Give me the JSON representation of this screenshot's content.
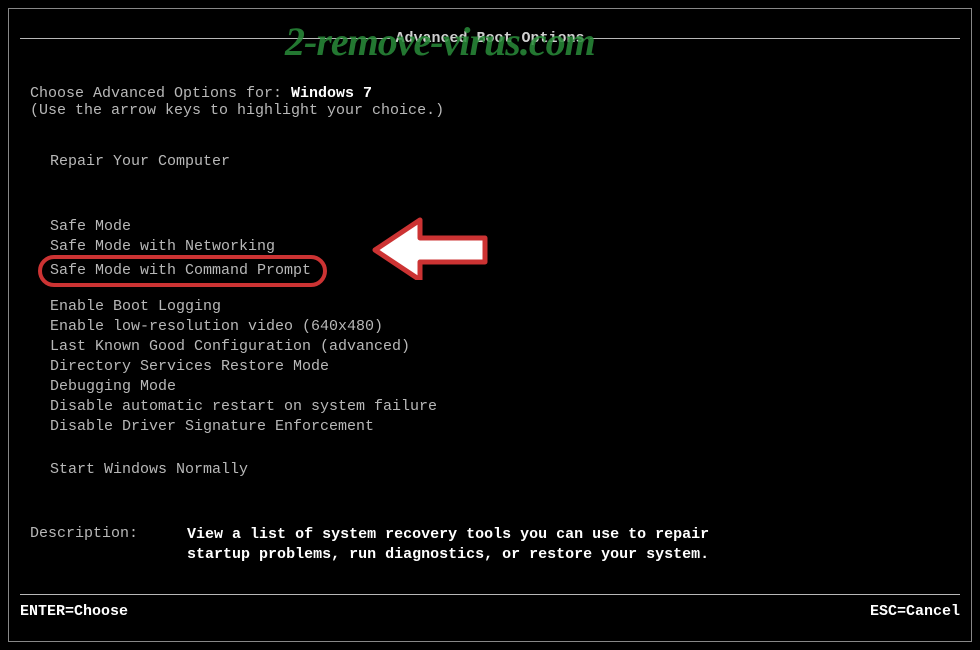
{
  "watermark": "2-remove-virus.com",
  "header": {
    "title": "Advanced Boot Options"
  },
  "intro": {
    "prefix": "Choose Advanced Options for: ",
    "os": "Windows 7",
    "hint": "(Use the arrow keys to highlight your choice.)"
  },
  "options": {
    "repair": "Repair Your Computer",
    "safe1": "Safe Mode",
    "safe2": "Safe Mode with Networking",
    "safe3": "Safe Mode with Command Prompt",
    "opt1": "Enable Boot Logging",
    "opt2": "Enable low-resolution video (640x480)",
    "opt3": "Last Known Good Configuration (advanced)",
    "opt4": "Directory Services Restore Mode",
    "opt5": "Debugging Mode",
    "opt6": "Disable automatic restart on system failure",
    "opt7": "Disable Driver Signature Enforcement",
    "start": "Start Windows Normally"
  },
  "description": {
    "label": "Description:",
    "line1": "View a list of system recovery tools you can use to repair",
    "line2": "startup problems, run diagnostics, or restore your system."
  },
  "footer": {
    "enter": "ENTER=Choose",
    "esc": "ESC=Cancel"
  }
}
